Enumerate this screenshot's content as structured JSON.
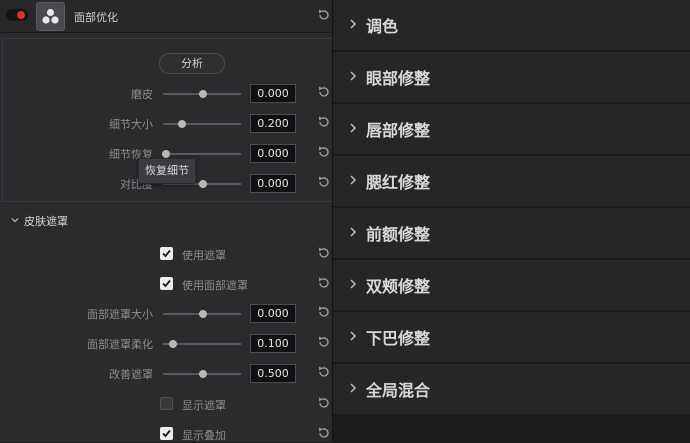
{
  "node": {
    "title": "面部优化",
    "icon": "node-icon"
  },
  "analysis": {
    "button_label": "分析",
    "sliders": [
      {
        "label": "磨皮",
        "value": "0.000",
        "level": 0.5
      },
      {
        "label": "细节大小",
        "value": "0.200",
        "level": 0.22
      },
      {
        "label": "细节恢复",
        "value": "0.000",
        "level": 0.0
      },
      {
        "label": "对比度",
        "value": "0.000",
        "level": 0.5
      }
    ],
    "tooltip": "恢复细节"
  },
  "skin_mask": {
    "title": "皮肤遮罩",
    "use_mask": {
      "label": "使用遮罩",
      "checked": true
    },
    "use_face_mask": {
      "label": "使用面部遮罩",
      "checked": true
    },
    "sliders": [
      {
        "label": "面部遮罩大小",
        "value": "0.000",
        "level": 0.5
      },
      {
        "label": "面部遮罩柔化",
        "value": "0.100",
        "level": 0.1
      },
      {
        "label": "改善遮罩",
        "value": "0.500",
        "level": 0.5
      }
    ],
    "show_mask": {
      "label": "显示遮罩",
      "checked": false
    },
    "show_overlay": {
      "label": "显示叠加",
      "checked": true
    }
  },
  "right_panel": {
    "items": [
      {
        "label": "调色"
      },
      {
        "label": "眼部修整"
      },
      {
        "label": "唇部修整"
      },
      {
        "label": "腮红修整"
      },
      {
        "label": "前额修整"
      },
      {
        "label": "双颊修整"
      },
      {
        "label": "下巴修整"
      },
      {
        "label": "全局混合"
      }
    ]
  },
  "colors": {
    "toggle_on": "#e0312c",
    "panel_bg": "#2b2b2e",
    "row_bg": "#262629"
  }
}
